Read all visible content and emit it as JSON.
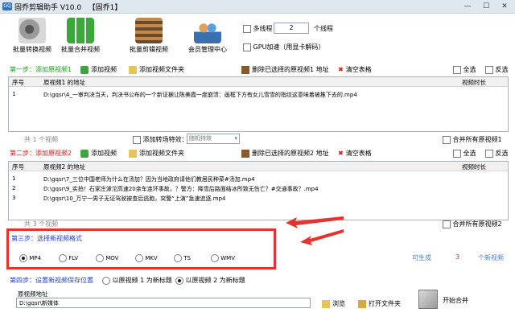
{
  "window": {
    "title": "固乔剪辑助手 V10.0   【固乔1】",
    "icon_text": "GQ"
  },
  "toolbar": {
    "buttons": [
      {
        "label": "批量转换视频"
      },
      {
        "label": "批量合并视频"
      },
      {
        "label": "批量剪辑视频"
      },
      {
        "label": "会员管理中心"
      }
    ],
    "multithread_label": "多线程",
    "thread_count": "2",
    "thread_unit": "个线程",
    "gpu_label": "GPU加速（用显卡解码）"
  },
  "step1": {
    "title": "第一步：添加原视频1",
    "add_video": "添加视频",
    "add_folder": "添加视频文件夹",
    "remove_selected": "删除已选择的原视频1 地址",
    "clear_table": "清空表格",
    "select_all": "全选",
    "invert": "反选",
    "columns": [
      "序号",
      "原视频1 的地址",
      "视频时长"
    ],
    "rows": [
      {
        "index": "1",
        "path": "D:\\gqsr\\4_一审判决当天，判决书公布的一个新证据让陈美霞一度崩溃：画框下方有女儿雪雪的指纹这意味着被推下去的.mp4",
        "duration": ""
      }
    ],
    "count_text": "共 1 个视频",
    "add_transition_label": "添加转场特效：",
    "transition_value": "随机特效",
    "merge_all_label": "合并所有原视频1"
  },
  "step2": {
    "title": "第二步：添加原视频2",
    "add_video": "添加视频",
    "add_folder": "添加视频文件夹",
    "remove_selected": "删除已选择的原视频2 地址",
    "clear_table": "清空表格",
    "select_all": "全选",
    "invert": "反选",
    "columns": [
      "序号",
      "原视频2 的地址",
      "视频时长"
    ],
    "rows": [
      {
        "index": "1",
        "path": "D:\\gqsr\\7_三位中国老师为什么在汤加？因为当地政府请他们教居民种菜#汤加.mp4",
        "duration": ""
      },
      {
        "index": "2",
        "path": "D:\\gqsr\\9_实拍！石家庄滹沱高速20余车连环事故，？警方：降雪后路面结冰所致无伤亡？#交通事故？.mp4",
        "duration": ""
      },
      {
        "index": "3",
        "path": "D:\\gqsr\\10_万宁一男子无证驾驶被查后逃跑，突警“上演”急速追逐.mp4",
        "duration": ""
      }
    ],
    "count_text": "共 3 个视频",
    "merge_all_label": "合并所有原视频2"
  },
  "step3": {
    "title": "第三步：选择新视频格式",
    "formats": [
      "MP4",
      "FLV",
      "MOV",
      "MKV",
      "TS",
      "WMV"
    ],
    "selected_format": "MP4",
    "can_generate": "可生成",
    "generate_count": "3",
    "generate_unit": "个新视频"
  },
  "step4": {
    "title": "第四步：设置新视频保存位置",
    "option1": "以原视频 1 为新标题",
    "option2": "以原视频 2 为新标题",
    "column_header": "原视频地址",
    "save_path": "D:\\gqsr\\新媒体",
    "browse": "浏览",
    "open_folder": "打开文件夹",
    "start_merge": "开始合并"
  },
  "colors": {
    "accent_red": "#e8322d",
    "step_green": "#1b9b1b",
    "step_red": "#d01a1a",
    "step_blue": "#1f3fd8"
  }
}
